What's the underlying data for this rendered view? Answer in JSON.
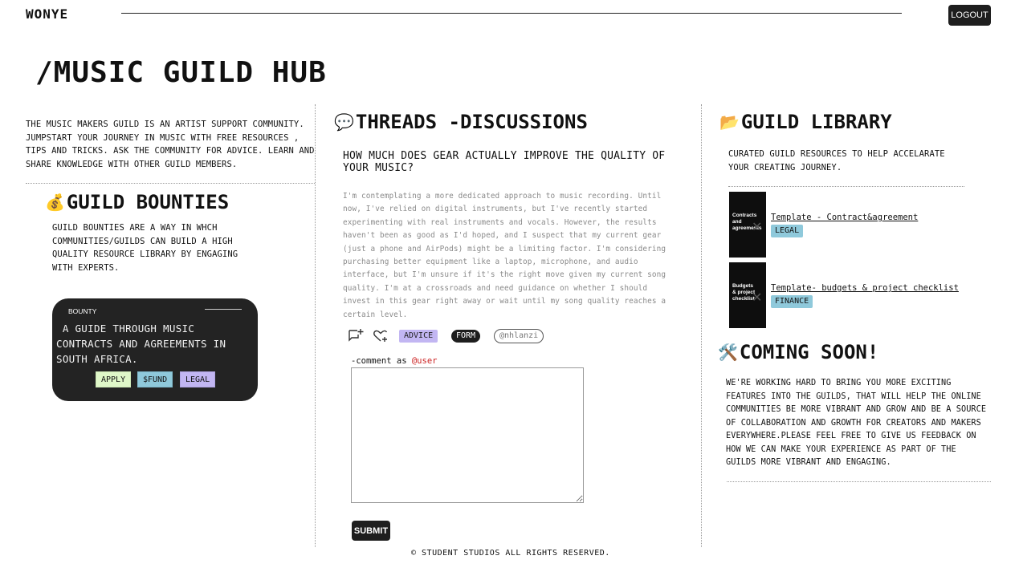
{
  "header": {
    "brand": "WONYE",
    "logout_label": "LOGOUT"
  },
  "page": {
    "title": "/MUSIC GUILD HUB"
  },
  "intro": {
    "text": "THE MUSIC MAKERS GUILD IS AN ARTIST SUPPORT COMMUNITY.\nJUMPSTART YOUR JOURNEY IN MUSIC WITH FREE RESOURCES ,\nTIPS AND TRICKS. ASK THE COMMUNITY FOR ADVICE. LEARN AND\nSHARE KNOWLEDGE WITH OTHER GUILD MEMBERS."
  },
  "bounties": {
    "icon": "money-bag-icon",
    "emoji": "💰",
    "heading": "GUILD BOUNTIES",
    "description": "GUILD BOUNTIES ARE A WAY IN WHCH COMMUNITIES/GUILDS CAN BUILD A HIGH QUALITY RESOURCE LIBRARY BY ENGAGING WITH EXPERTS.",
    "card": {
      "tag": "BOUNTY",
      "title": "A GUIDE THROUGH MUSIC CONTRACTS AND AGREEMENTS IN SOUTH AFRICA.",
      "apply_label": "APPLY",
      "fund_label": "$FUND",
      "category_label": "LEGAL",
      "colors": {
        "apply": "#dff7c8",
        "fund": "#8fc9db",
        "category": "#c2b6f2"
      }
    }
  },
  "threads": {
    "icon": "speech-bubble-icon",
    "emoji": "💬",
    "heading": "THREADS -DISCUSSIONS",
    "question": "HOW MUCH DOES GEAR ACTUALLY IMPROVE THE QUALITY OF YOUR MUSIC?",
    "body": "I'm contemplating a more dedicated approach to music recording. Until now, I've relied on digital instruments, but I've recently started experimenting with real instruments and vocals. However, the results haven't been as good as I'd hoped, and I suspect that my current gear (just a phone and AirPods) might be a limiting factor. I'm considering purchasing better equipment like a laptop, microphone, and audio interface, but I'm unsure if it's the right move given my current song quality. I'm at a crossroads and need guidance on whether I should invest in this gear right away or wait until my song quality reaches a certain level.",
    "tags": {
      "advice": "ADVICE",
      "form": "FORM",
      "user": "@nhlanzi"
    },
    "colors": {
      "advice": "#c2b6f2",
      "form": "#1e1e1e"
    },
    "comment": {
      "label_prefix": "-comment as ",
      "user": "@user",
      "user_color": "#cc2222",
      "submit_label": "SUBMIT"
    }
  },
  "library": {
    "icon": "folder-icon",
    "emoji": "📂",
    "heading": "GUILD LIBRARY",
    "description": "CURATED GUILD RESOURCES TO HELP ACCELARATE YOUR CREATING JOURNEY.",
    "items": [
      {
        "thumb_text": "Contracts and agreements",
        "title": "Template - Contract&agreement",
        "tag": "LEGAL"
      },
      {
        "thumb_text": "Budgets & project checklist",
        "title": "Template- budgets & project checklist",
        "tag": "FINANCE"
      }
    ]
  },
  "coming_soon": {
    "icon": "tools-icon",
    "emoji": "🛠️",
    "heading": "COMING SOON!",
    "text": "WE'RE WORKING HARD TO BRING YOU MORE EXCITING FEATURES INTO THE GUILDS, THAT WILL HELP THE ONLINE COMMUNITIES BE MORE VIBRANT AND GROW AND BE A SOURCE OF COLLABORATION AND GROWTH FOR CREATORS AND MAKERS EVERYWHERE.PLEASE FEEL FREE TO GIVE US FEEDBACK ON HOW WE CAN MAKE YOUR EXPERIENCE AS PART OF THE GUILDS MORE VIBRANT AND ENGAGING."
  },
  "footer": {
    "text": "© STUDENT STUDIOS ALL RIGHTS RESERVED."
  }
}
